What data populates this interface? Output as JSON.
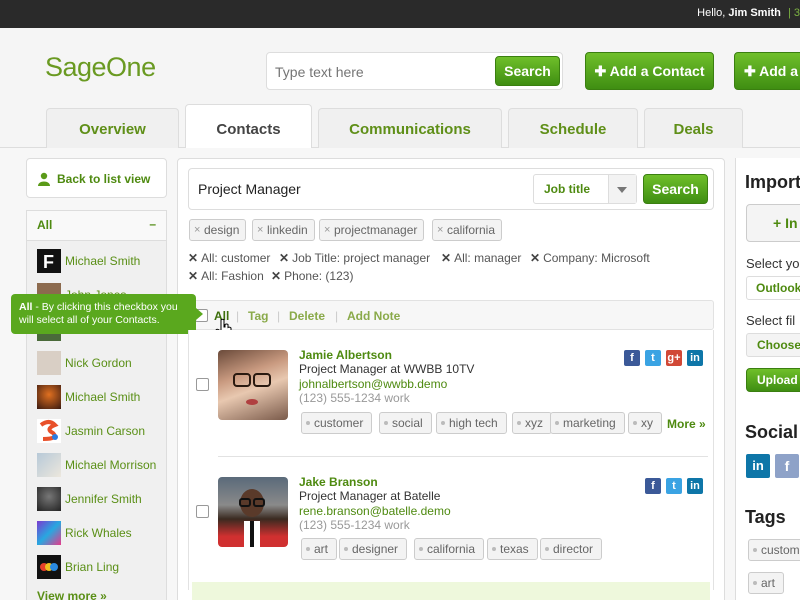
{
  "topbar": {
    "hello_prefix": "Hello,",
    "user_name": "Jim Smith",
    "sep": "| 3"
  },
  "header": {
    "logo": "SageOne",
    "search_placeholder": "Type text here",
    "search_button": "Search",
    "add_contact": "Add a Contact",
    "add_more": "Add a"
  },
  "tabs": [
    "Overview",
    "Contacts",
    "Communications",
    "Schedule",
    "Deals"
  ],
  "sidebar": {
    "back_label": "Back to list view",
    "all_label": "All",
    "collapse": "–",
    "contacts": [
      "Michael Smith",
      "John Jones",
      "",
      "Nick Gordon",
      "Michael Smith",
      "Jasmin Carson",
      "Michael Morrison",
      "Jennifer Smith",
      "Rick Whales",
      "Brian Ling"
    ],
    "view_more": "View more »"
  },
  "tooltip": {
    "bold": "All",
    "text": " - By clicking this checkbox you will select all of your Contacts."
  },
  "query": {
    "value": "Project Manager",
    "field": "Job title",
    "button": "Search"
  },
  "chips": [
    "design",
    "linkedin",
    "projectmanager",
    "california"
  ],
  "filters": [
    "All: customer",
    "Job Title: project manager",
    "All: manager",
    "Company: Microsoft",
    "All: Fashion",
    "Phone: (123)"
  ],
  "actions": {
    "all": "All",
    "tag": "Tag",
    "delete": "Delete",
    "add_note": "Add Note"
  },
  "contacts": [
    {
      "name": "Jamie Albertson",
      "title_prefix": "Project Manager at",
      "company": "WWBB 10TV",
      "email": "johnalbertson@wwbb.demo",
      "phone": "(123) 555-1234 work",
      "tags": [
        "customer",
        "social",
        "high tech",
        "xyz",
        "marketing",
        "xy"
      ],
      "more": "More »",
      "social": [
        "facebook",
        "twitter",
        "google-plus",
        "linkedin"
      ]
    },
    {
      "name": "Jake Branson",
      "title_prefix": "Project Manager at",
      "company": "Batelle",
      "email": "rene.branson@batelle.demo",
      "phone": "(123) 555-1234 work",
      "tags": [
        "art",
        "designer",
        "california",
        "texas",
        "director"
      ],
      "social": [
        "facebook",
        "twitter",
        "linkedin"
      ]
    }
  ],
  "right": {
    "import_title": "Import",
    "import_btn": "+ In",
    "select_label": "Select yo",
    "outlook": "Outlook",
    "select_file": "Select fil",
    "choose": "Choose",
    "upload": "Upload",
    "social_title": "Social",
    "tags_title": "Tags",
    "tag1": "custom",
    "tag2": "art"
  }
}
